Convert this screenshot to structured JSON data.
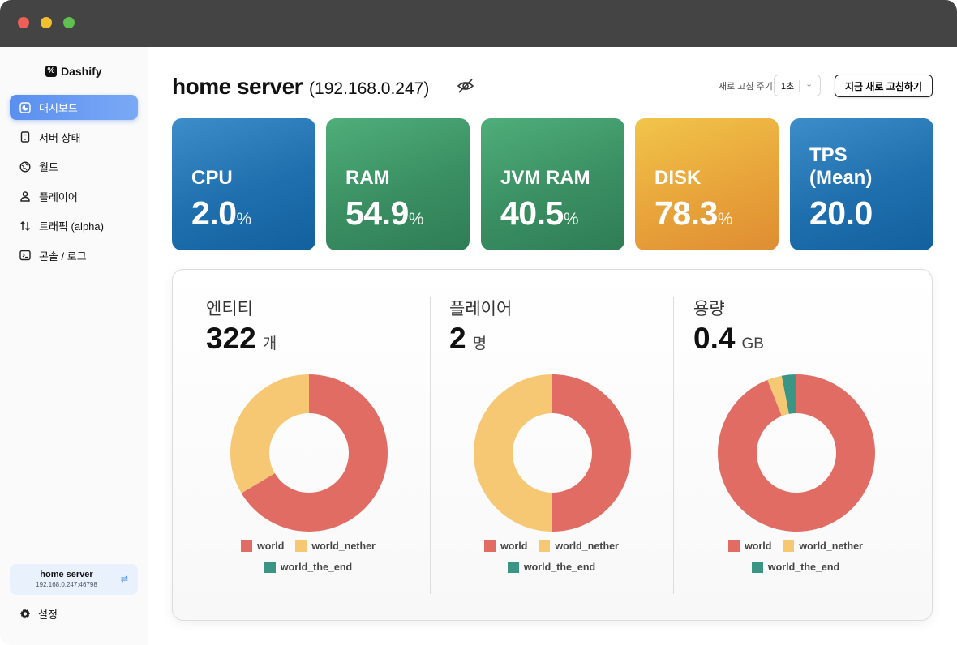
{
  "window": {
    "traffic_lights": [
      "close",
      "minimize",
      "zoom"
    ]
  },
  "sidebar": {
    "brand": "Dashify",
    "items": [
      {
        "label": "대시보드",
        "icon": "dashboard-icon",
        "active": true
      },
      {
        "label": "서버 상태",
        "icon": "server-icon",
        "active": false
      },
      {
        "label": "월드",
        "icon": "globe-icon",
        "active": false
      },
      {
        "label": "플레이어",
        "icon": "user-icon",
        "active": false
      },
      {
        "label": "트래픽 (alpha)",
        "icon": "arrows-updown-icon",
        "active": false
      },
      {
        "label": "콘솔 / 로그",
        "icon": "terminal-icon",
        "active": false
      }
    ],
    "server": {
      "name": "home server",
      "address": "192.168.0.247:46798",
      "icon": "switch-icon"
    },
    "settings": {
      "label": "설정",
      "icon": "gear-icon"
    }
  },
  "header": {
    "title": "home server",
    "ip": "(192.168.0.247)",
    "visibility_icon": "eye-off-icon",
    "refresh_label": "새로 고침 주기",
    "refresh_interval": "1초",
    "refresh_button": "지금 새로 고침하기"
  },
  "metrics": [
    {
      "label": "CPU",
      "value": "2.0",
      "unit": "%",
      "color": "blue"
    },
    {
      "label": "RAM",
      "value": "54.9",
      "unit": "%",
      "color": "green"
    },
    {
      "label": "JVM RAM",
      "value": "40.5",
      "unit": "%",
      "color": "green"
    },
    {
      "label": "DISK",
      "value": "78.3",
      "unit": "%",
      "color": "orange"
    },
    {
      "label": "TPS",
      "label2": "(Mean)",
      "value": "20.0",
      "unit": "",
      "color": "blue"
    }
  ],
  "colors": {
    "world": "#e06c63",
    "world_nether": "#f7c873",
    "world_the_end": "#3a9585"
  },
  "stats": [
    {
      "title": "엔티티",
      "value": "322",
      "unit": "개"
    },
    {
      "title": "플레이어",
      "value": "2",
      "unit": "명"
    },
    {
      "title": "용량",
      "value": "0.4",
      "unit": "GB"
    }
  ],
  "chart_data": [
    {
      "type": "pie",
      "title": "엔티티",
      "categories": [
        "world",
        "world_nether",
        "world_the_end"
      ],
      "values": [
        214,
        108,
        0
      ]
    },
    {
      "type": "pie",
      "title": "플레이어",
      "categories": [
        "world",
        "world_nether",
        "world_the_end"
      ],
      "values": [
        1,
        1,
        0
      ]
    },
    {
      "type": "pie",
      "title": "용량",
      "categories": [
        "world",
        "world_nether",
        "world_the_end"
      ],
      "values": [
        0.376,
        0.012,
        0.012
      ]
    }
  ]
}
